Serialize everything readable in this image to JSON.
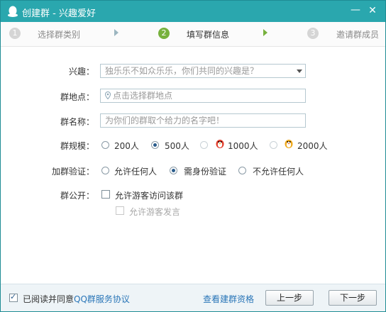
{
  "window": {
    "title": "创建群 - 兴趣爱好",
    "min_label": "—",
    "close_label": "✕"
  },
  "steps": [
    {
      "number": "1",
      "label": "选择群类别"
    },
    {
      "number": "2",
      "label": "填写群信息"
    },
    {
      "number": "3",
      "label": "邀请群成员"
    }
  ],
  "form": {
    "interest": {
      "label": "兴趣：",
      "placeholder": "独乐乐不如众乐乐，你们共同的兴趣是？"
    },
    "location": {
      "label": "群地点：",
      "placeholder": "点击选择群地点"
    },
    "name": {
      "label": "群名称：",
      "placeholder": "为你们的群取个给力的名字吧！"
    },
    "scale": {
      "label": "群规模：",
      "options": [
        "200人",
        "500人",
        "1000人",
        "2000人"
      ],
      "selected": "500人"
    },
    "verify": {
      "label": "加群验证：",
      "options": [
        "允许任何人",
        "需身份验证",
        "不允许任何人"
      ],
      "selected": "需身份验证"
    },
    "public": {
      "label": "群公开：",
      "allow_visitor": "允许游客访问该群",
      "allow_speak": "允许游客发言"
    }
  },
  "footer": {
    "agree_text": "已阅读并同意",
    "agree_link": "QQ群服务协议",
    "qualify_link": "查看建群资格",
    "prev_button": "上一步",
    "next_button": "下一步"
  }
}
